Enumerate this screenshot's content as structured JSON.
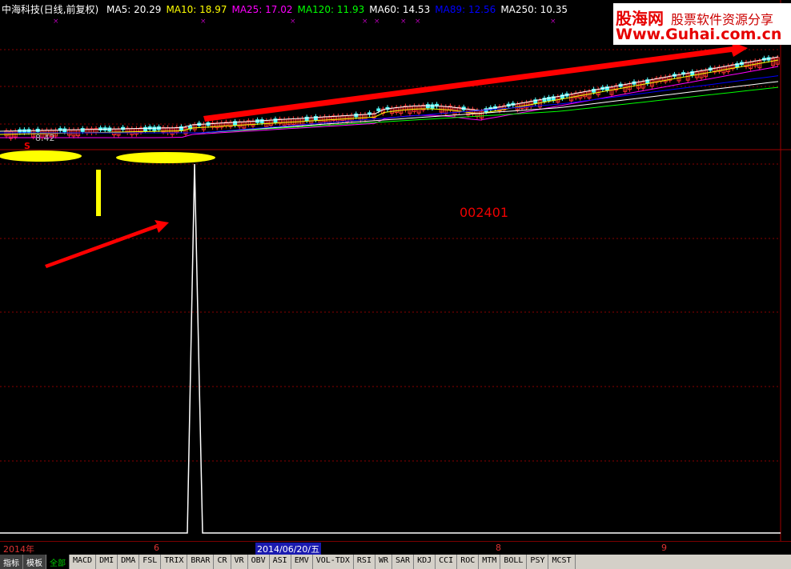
{
  "header": {
    "stock_title": "中海科技(日线,前复权)",
    "ma_items": [
      {
        "label": "MA5: 20.29",
        "color": "#ffffff"
      },
      {
        "label": "MA10: 18.97",
        "color": "#ffff00"
      },
      {
        "label": "MA25: 17.02",
        "color": "#ff00ff"
      },
      {
        "label": "MA120: 11.93",
        "color": "#00ff00"
      },
      {
        "label": "MA60: 14.53",
        "color": "#ffffff"
      },
      {
        "label": "MA89: 12.56",
        "color": "#0000ff"
      },
      {
        "label": "MA250: 10.35",
        "color": "#ffffff"
      }
    ]
  },
  "logo": {
    "brand": "股海网",
    "slogan": "股票软件资源分享",
    "url": "Www.Guhai.com.cn"
  },
  "chart": {
    "price_label": "8.42",
    "signal_mark": "S",
    "stock_code": "002401"
  },
  "date_axis": {
    "labels": [
      "2014年",
      "6",
      "2014/06/20/五",
      "8",
      "9"
    ]
  },
  "tabs": [
    {
      "label": "指标",
      "style": "dark"
    },
    {
      "label": "模板",
      "style": "dark"
    },
    {
      "label": "全部",
      "style": "active"
    },
    {
      "label": "MACD",
      "style": "normal"
    },
    {
      "label": "DMI",
      "style": "normal"
    },
    {
      "label": "DMA",
      "style": "normal"
    },
    {
      "label": "FSL",
      "style": "normal"
    },
    {
      "label": "TRIX",
      "style": "normal"
    },
    {
      "label": "BRAR",
      "style": "normal"
    },
    {
      "label": "CR",
      "style": "normal"
    },
    {
      "label": "VR",
      "style": "normal"
    },
    {
      "label": "OBV",
      "style": "normal"
    },
    {
      "label": "ASI",
      "style": "normal"
    },
    {
      "label": "EMV",
      "style": "normal"
    },
    {
      "label": "VOL-TDX",
      "style": "normal"
    },
    {
      "label": "RSI",
      "style": "normal"
    },
    {
      "label": "WR",
      "style": "normal"
    },
    {
      "label": "SAR",
      "style": "normal"
    },
    {
      "label": "KDJ",
      "style": "normal"
    },
    {
      "label": "CCI",
      "style": "normal"
    },
    {
      "label": "ROC",
      "style": "normal"
    },
    {
      "label": "MTM",
      "style": "normal"
    },
    {
      "label": "BOLL",
      "style": "normal"
    },
    {
      "label": "PSY",
      "style": "normal"
    },
    {
      "label": "MCST",
      "style": "normal"
    }
  ],
  "colors": {
    "up_candle": "#ff3232",
    "down_candle": "#54ffff",
    "grid": "#8a0000",
    "highlight": "#ffff00",
    "arrow": "#ff0000"
  }
}
